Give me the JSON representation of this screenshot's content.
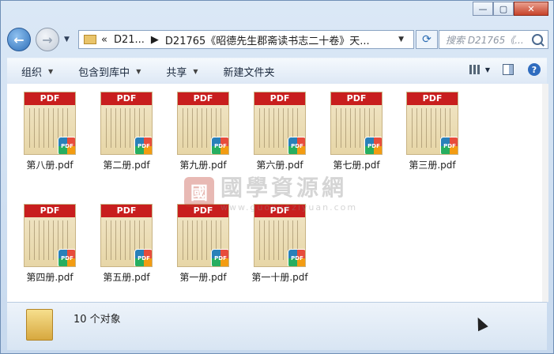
{
  "address": {
    "overflow": "«",
    "segments": [
      "D21...",
      "D21765《昭德先生郡斋读书志二十卷》天..."
    ]
  },
  "search": {
    "placeholder": "搜索 D21765《..."
  },
  "toolbar": {
    "organize": "组织",
    "include_library": "包含到库中",
    "share": "共享",
    "new_folder": "新建文件夹"
  },
  "files": [
    {
      "name": "第八册.pdf"
    },
    {
      "name": "第二册.pdf"
    },
    {
      "name": "第九册.pdf"
    },
    {
      "name": "第六册.pdf"
    },
    {
      "name": "第七册.pdf"
    },
    {
      "name": "第三册.pdf"
    },
    {
      "name": "第四册.pdf"
    },
    {
      "name": "第五册.pdf"
    },
    {
      "name": "第一册.pdf"
    },
    {
      "name": "第一十册.pdf"
    }
  ],
  "thumb_badge": "PDF",
  "status": {
    "count_text": "10 个对象"
  },
  "watermark": {
    "seal": "國",
    "text": "國學資源網",
    "url": "www.guoxueziyuan.com"
  },
  "colors": {
    "pdf_red": "#c81e1e",
    "accent_blue": "#2e6fb8"
  }
}
